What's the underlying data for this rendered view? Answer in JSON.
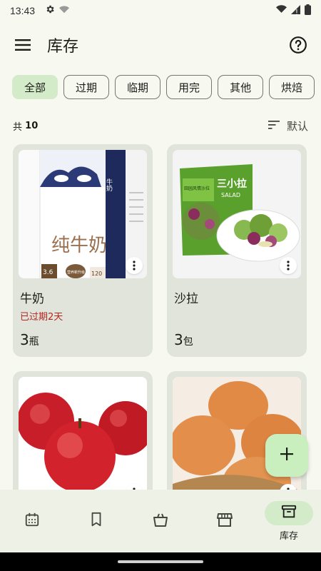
{
  "status_bar": {
    "time": "13:43"
  },
  "app_bar": {
    "title": "库存"
  },
  "filters": [
    {
      "label": "全部",
      "selected": true
    },
    {
      "label": "过期",
      "selected": false
    },
    {
      "label": "临期",
      "selected": false
    },
    {
      "label": "用完",
      "selected": false
    },
    {
      "label": "其他",
      "selected": false
    },
    {
      "label": "烘焙",
      "selected": false
    }
  ],
  "summary": {
    "prefix": "共",
    "count": "10",
    "sort_label": "默认"
  },
  "items": [
    {
      "name": "牛奶",
      "expiry": "已过期2天",
      "quantity": "3",
      "unit": "瓶",
      "image": "milk-carton"
    },
    {
      "name": "沙拉",
      "expiry": "",
      "quantity": "3",
      "unit": "包",
      "image": "salad-bag"
    },
    {
      "name": "",
      "expiry": "",
      "quantity": "",
      "unit": "",
      "image": "apples"
    },
    {
      "name": "",
      "expiry": "",
      "quantity": "",
      "unit": "",
      "image": "eggs"
    }
  ],
  "product_art": {
    "milk_main": "纯牛奶",
    "milk_side": "牛奶",
    "milk_fat": "3.6",
    "milk_badge": "营养新升级",
    "milk_vol": "120",
    "salad_brand": "三小拉",
    "salad_en": "SALAD",
    "salad_flavor": "田园风情沙拉"
  },
  "bottom_nav": [
    {
      "icon": "calendar-icon",
      "label": "",
      "active": false
    },
    {
      "icon": "bookmark-icon",
      "label": "",
      "active": false
    },
    {
      "icon": "basket-icon",
      "label": "",
      "active": false
    },
    {
      "icon": "store-icon",
      "label": "",
      "active": false
    },
    {
      "icon": "archive-icon",
      "label": "库存",
      "active": true
    }
  ],
  "colors": {
    "accent": "#d3ebc9",
    "fab": "#c8efbd",
    "expired": "#b3261e",
    "card": "#e1e4da",
    "background": "#f7f9f1"
  }
}
